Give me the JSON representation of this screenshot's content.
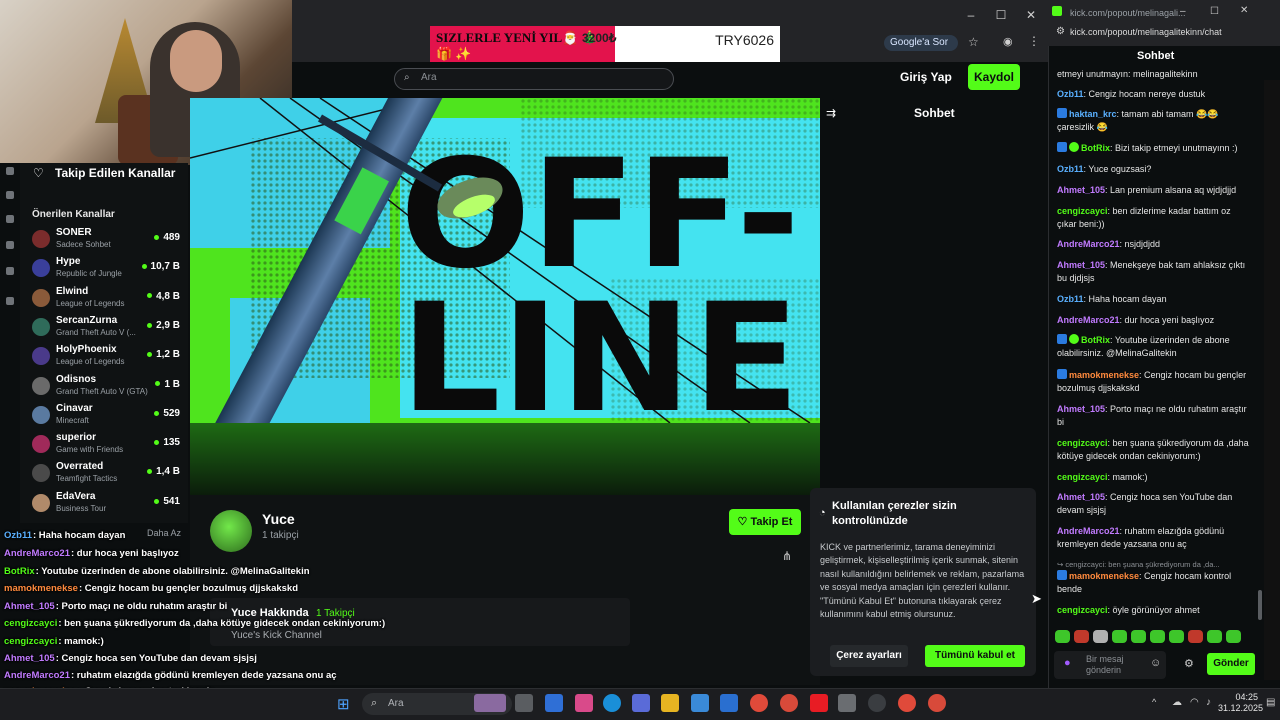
{
  "browser": {
    "promo_left": "SIZLERLE YENİ YIL🎅 🎄 🎁 ✨",
    "promo_price": "3200₺",
    "promo_right": "TRY6026",
    "google_btn": "Google'a Sor"
  },
  "header": {
    "search_placeholder": "Ara",
    "login": "Giriş Yap",
    "signup": "Kaydol"
  },
  "sidebar": {
    "following_title": "Takip Edilen Kanallar",
    "recommended_title": "Önerilen Kanallar",
    "channels": [
      {
        "name": "SONER",
        "game": "Sadece Sohbet",
        "viewers": "489",
        "color": "#7a2c2c"
      },
      {
        "name": "Hype",
        "game": "Republic of Jungle",
        "viewers": "10,7 B",
        "color": "#3a3f9a"
      },
      {
        "name": "Elwind",
        "game": "League of Legends",
        "viewers": "4,8 B",
        "color": "#8a5a3a"
      },
      {
        "name": "SercanZurna",
        "game": "Grand Theft Auto V (...",
        "viewers": "2,9 B",
        "color": "#2f6b5a"
      },
      {
        "name": "HolyPhoenix",
        "game": "League of Legends",
        "viewers": "1,2 B",
        "color": "#4a3a8a"
      },
      {
        "name": "Odisnos",
        "game": "Grand Theft Auto V (GTA)",
        "viewers": "1 B",
        "color": "#6a6a6a"
      },
      {
        "name": "Cinavar",
        "game": "Minecraft",
        "viewers": "529",
        "color": "#5a7aa0"
      },
      {
        "name": "superior",
        "game": "Game with Friends",
        "viewers": "135",
        "color": "#a02a5a"
      },
      {
        "name": "Overrated",
        "game": "Teamfight Tactics",
        "viewers": "1,4 B",
        "color": "#4a4a4a"
      },
      {
        "name": "EdaVera",
        "game": "Business Tour",
        "viewers": "541",
        "color": "#b08a6a"
      }
    ],
    "show_less": "Daha Az"
  },
  "stream": {
    "offline_line1": "OFF-",
    "offline_line2": "LINE",
    "chat_title": "Sohbet"
  },
  "channel": {
    "name": "Yuce",
    "followers": "1 takipçi",
    "follow_btn": "Takip Et",
    "about_title": "Yuce Hakkında",
    "about_followers": "1 Takipçi",
    "about_desc": "Yuce's Kick Channel"
  },
  "overlay_chat": [
    {
      "user": "Ozb11",
      "text": ": Haha hocam dayan",
      "color": "#5ab0ff"
    },
    {
      "user": "AndreMarco21",
      "text": ": dur hoca yeni başlıyoz",
      "color": "#c17bff"
    },
    {
      "user": "BotRix",
      "text": ": Youtube üzerinden de abone olabilirsiniz. @MelinaGalitekin",
      "color": "#53fc18"
    },
    {
      "user": "mamokmenekse",
      "text": ": Cengiz hocam bu gençler bozulmuş djjskakskd",
      "color": "#ff8a3d"
    },
    {
      "user": "Ahmet_105",
      "text": ": Porto maçı ne oldu ruhatım araştır bi",
      "color": "#c17bff"
    },
    {
      "user": "cengizcayci",
      "text": ": ben şuana şükrediyorum da ,daha kötüye gidecek ondan cekiniyorum:)",
      "color": "#53fc18"
    },
    {
      "user": "cengizcayci",
      "text": ": mamok:)",
      "color": "#53fc18"
    },
    {
      "user": "Ahmet_105",
      "text": ": Cengiz hoca sen YouTube dan devam sjsjsj",
      "color": "#c17bff"
    },
    {
      "user": "AndreMarco21",
      "text": ": ruhatım elazığda gödünü kremleyen dede yazsana onu aç",
      "color": "#c17bff"
    },
    {
      "user": "mamokmenekse",
      "text": ": Cengiz hocam kontrol bende",
      "color": "#ff8a3d"
    },
    {
      "user": "cengizcayci",
      "text": ": öyle görünüyor ahmet",
      "color": "#53fc18"
    }
  ],
  "cookie": {
    "title": "Kullanılan çerezler sizin kontrolünüzde",
    "body": "KICK ve partnerlerimiz, tarama deneyiminizi geliştirmek, kişiselleştirilmiş içerik sunmak, sitenin nasıl kullanıldığını belirlemek ve reklam, pazarlama ve sosyal medya amaçları için çerezleri kullanır. \"Tümünü Kabul Et\" butonuna tıklayarak çerez kullanımını kabul etmiş olursunuz.",
    "settings_btn": "Çerez ayarları",
    "accept_btn": "Tümünü kabul et"
  },
  "popout": {
    "url_title": "kick.com/popout/melinagali...",
    "url": "kick.com/popout/melinagalitekinn/chat",
    "title": "Sohbet",
    "messages": [
      {
        "user": "",
        "text": "etmeyi unutmayın: melinagalitekinn",
        "color": "#e6e6e6",
        "badge": "none"
      },
      {
        "user": "Ozb11",
        "text": ": Cengiz hocam nereye dustuk",
        "color": "#5ab0ff",
        "badge": "none"
      },
      {
        "user": "haktan_krc",
        "text": ": tamam abi tamam 😂😂 çaresizlik 😂",
        "color": "#5ab0ff",
        "badge": "blue"
      },
      {
        "user": "BotRix",
        "text": ": Bizi takip etmeyi unutmayınn :)",
        "color": "#53fc18",
        "badge": "bot"
      },
      {
        "user": "Ozb11",
        "text": ": Yuce oguzsasi?",
        "color": "#5ab0ff",
        "badge": "none"
      },
      {
        "user": "Ahmet_105",
        "text": ": Lan premium alsana aq wjdjdjjd",
        "color": "#c17bff",
        "badge": "none"
      },
      {
        "user": "cengizcayci",
        "text": ": ben dizlerime kadar battım oz çıkar beni:))",
        "color": "#53fc18",
        "badge": "none"
      },
      {
        "user": "AndreMarco21",
        "text": ": nsjdjdjdd",
        "color": "#c17bff",
        "badge": "none"
      },
      {
        "user": "Ahmet_105",
        "text": ": Menekşeye bak tam ahlaksız çıktı bu djdjsjs",
        "color": "#c17bff",
        "badge": "none"
      },
      {
        "user": "Ozb11",
        "text": ": Haha hocam dayan",
        "color": "#5ab0ff",
        "badge": "none"
      },
      {
        "user": "AndreMarco21",
        "text": ": dur hoca yeni başlıyoz",
        "color": "#c17bff",
        "badge": "none"
      },
      {
        "user": "BotRix",
        "text": ": Youtube üzerinden de abone olabilirsiniz. @MelinaGalitekin",
        "color": "#53fc18",
        "badge": "bot"
      },
      {
        "user": "mamokmenekse",
        "text": ": Cengiz hocam bu gençler bozulmuş djjskakskd",
        "color": "#ff8a3d",
        "badge": "blue"
      },
      {
        "user": "Ahmet_105",
        "text": ": Porto maçı ne oldu ruhatım araştır bi",
        "color": "#c17bff",
        "badge": "none"
      },
      {
        "user": "cengizcayci",
        "text": ": ben şuana şükrediyorum da ,daha kötüye gidecek ondan cekiniyorum:)",
        "color": "#53fc18",
        "badge": "none"
      },
      {
        "user": "cengizcayci",
        "text": ": mamok:)",
        "color": "#53fc18",
        "badge": "none"
      },
      {
        "user": "Ahmet_105",
        "text": ": Cengiz hoca sen YouTube dan devam sjsjsj",
        "color": "#c17bff",
        "badge": "none"
      },
      {
        "user": "AndreMarco21",
        "text": ": ruhatım elazığda gödünü kremleyen dede yazsana onu aç",
        "color": "#c17bff",
        "badge": "none"
      },
      {
        "user": "",
        "text": "↪ cengizcayci: ben şuana şükrediyorum da ,da...",
        "color": "#8b8f94",
        "badge": "none"
      },
      {
        "user": "mamokmenekse",
        "text": ": Cengiz hocam kontrol bende",
        "color": "#ff8a3d",
        "badge": "blue"
      },
      {
        "user": "cengizcayci",
        "text": ": öyle görünüyor ahmet",
        "color": "#53fc18",
        "badge": "none"
      }
    ],
    "input_placeholder": "Bir mesaj gönderin",
    "send_btn": "Gönder"
  },
  "taskbar": {
    "search_placeholder": "Ara",
    "time": "04:25",
    "date": "31.12.2025"
  }
}
